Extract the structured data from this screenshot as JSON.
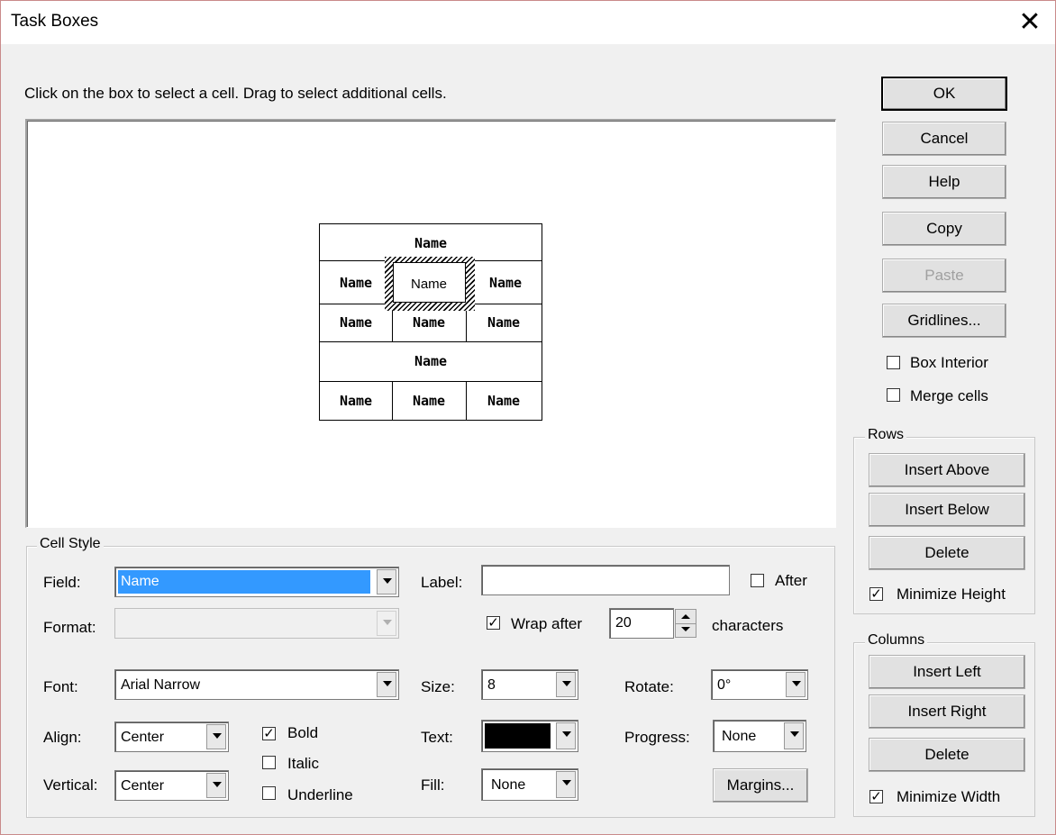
{
  "window": {
    "title": "Task Boxes",
    "close_glyph": "✕"
  },
  "instruction": "Click on the box to select a cell. Drag to select additional cells.",
  "preview": {
    "row1": "Name",
    "row2": [
      "Name",
      "Name",
      "Name"
    ],
    "row3": [
      "Name",
      "Name",
      "Name"
    ],
    "row4": "Name",
    "row5": [
      "Name",
      "Name",
      "Name"
    ]
  },
  "buttons": {
    "ok": "OK",
    "cancel": "Cancel",
    "help": "Help",
    "copy": "Copy",
    "paste": "Paste",
    "gridlines": "Gridlines..."
  },
  "options": {
    "box_interior": {
      "label": "Box Interior",
      "checked": false
    },
    "merge_cells": {
      "label": "Merge cells",
      "checked": false
    }
  },
  "rows_group": {
    "title": "Rows",
    "insert_above": "Insert Above",
    "insert_below": "Insert Below",
    "delete": "Delete",
    "minimize_height": {
      "label": "Minimize Height",
      "checked": true
    }
  },
  "columns_group": {
    "title": "Columns",
    "insert_left": "Insert Left",
    "insert_right": "Insert Right",
    "delete": "Delete",
    "minimize_width": {
      "label": "Minimize Width",
      "checked": true
    }
  },
  "cell_style": {
    "title": "Cell Style",
    "field_label": "Field:",
    "field_value": "Name",
    "label_label": "Label:",
    "label_value": "",
    "after": {
      "label": "After",
      "checked": false
    },
    "format_label": "Format:",
    "format_value": "",
    "wrap_after": {
      "label": "Wrap after",
      "checked": true
    },
    "wrap_value": "20",
    "characters_label": "characters",
    "font_label": "Font:",
    "font_value": "Arial Narrow",
    "size_label": "Size:",
    "size_value": "8",
    "rotate_label": "Rotate:",
    "rotate_value": "0°",
    "align_label": "Align:",
    "align_value": "Center",
    "bold": {
      "label": "Bold",
      "checked": true
    },
    "italic": {
      "label": "Italic",
      "checked": false
    },
    "underline": {
      "label": "Underline",
      "checked": false
    },
    "text_label": "Text:",
    "text_color": "#000000",
    "progress_label": "Progress:",
    "progress_value": "None",
    "vertical_label": "Vertical:",
    "vertical_value": "Center",
    "fill_label": "Fill:",
    "fill_value": "None",
    "margins_button": "Margins..."
  },
  "colors": {
    "selection": "#3399ff",
    "window_bg": "#f0f0f0"
  }
}
